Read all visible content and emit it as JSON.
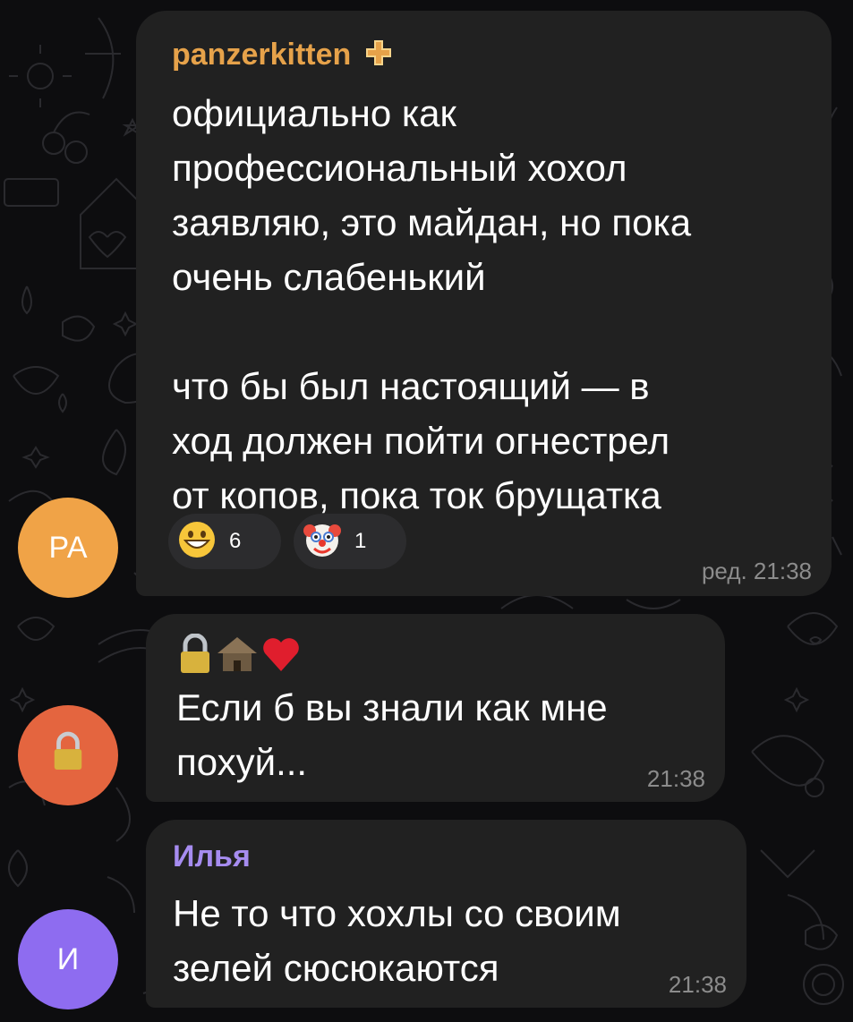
{
  "colors": {
    "background": "#0d0d0f",
    "bubble": "#212121",
    "sender_panzerkitten": "#e6a24a",
    "sender_ilya": "#a68cf0",
    "avatar_pa": "#f0a347",
    "avatar_lock": "#e4653f",
    "avatar_ilya": "#8e6cf0"
  },
  "messages": [
    {
      "sender": "panzerkitten",
      "sender_badge_icon": "plus-badge-icon",
      "text": "официально как\nпрофессиональный хохол\nзаявляю, это майдан, но пока\nочень слабенький\n\nчто бы был настоящий — в\nход должен пойти огнестрел\nот копов, пока ток брущатка",
      "reactions": [
        {
          "emoji": "grinning-face-icon",
          "count": "6"
        },
        {
          "emoji": "clown-face-icon",
          "count": "1"
        }
      ],
      "time": "ред. 21:38",
      "avatar": {
        "initials": "РА"
      }
    },
    {
      "emoji_status": [
        "lock-icon",
        "hut-icon",
        "red-heart-icon"
      ],
      "text": "Если б вы знали как мне\nпохуй...",
      "time": "21:38",
      "avatar": {
        "icon": "lock-icon"
      }
    },
    {
      "sender": "Илья",
      "text": "Не то что хохлы со своим\nзелей сюсюкаются",
      "time": "21:38",
      "avatar": {
        "initials": "И"
      }
    }
  ]
}
